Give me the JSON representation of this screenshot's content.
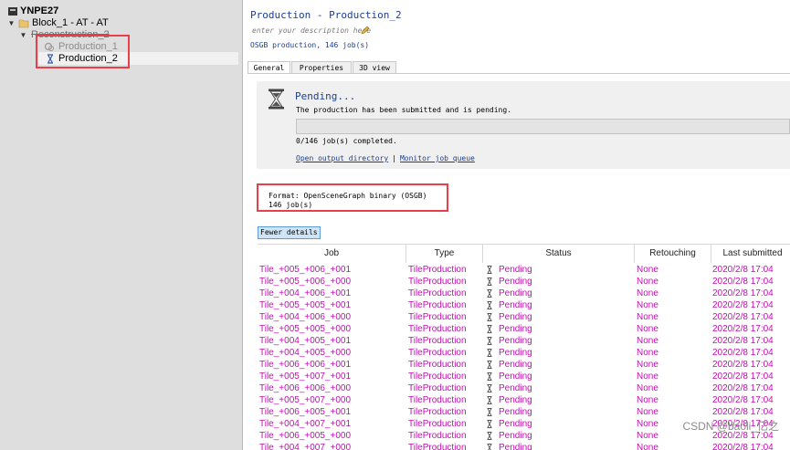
{
  "tree": {
    "root": "YNPE27",
    "block": "Block_1 - AT - AT",
    "reconstruction": "Reconstruction_2",
    "production_1": "Production_1",
    "production_2": "Production_2"
  },
  "panel": {
    "title": "Production - Production_2",
    "description_placeholder": "enter your description here",
    "summary": "OSGB production, 146 job(s)",
    "tabs": [
      "General",
      "Properties",
      "3D view"
    ],
    "status_title": "Pending...",
    "status_text": "The production has been submitted and is pending.",
    "progress": 0,
    "jobs_completed": "0/146 job(s) completed.",
    "link_output": "Open output directory",
    "link_separator": "|",
    "link_monitor": "Monitor job queue",
    "format_line": "Format: OpenSceneGraph binary (OSGB)",
    "jobs_count": "146 job(s)",
    "fewer_details": "Fewer details"
  },
  "jobs": {
    "columns": [
      "Job",
      "Type",
      "Status",
      "Retouching",
      "Last submitted"
    ],
    "rows": [
      [
        "Tile_+005_+006_+001",
        "TileProduction",
        "Pending",
        "None",
        "2020/2/8 17:04"
      ],
      [
        "Tile_+005_+006_+000",
        "TileProduction",
        "Pending",
        "None",
        "2020/2/8 17:04"
      ],
      [
        "Tile_+004_+006_+001",
        "TileProduction",
        "Pending",
        "None",
        "2020/2/8 17:04"
      ],
      [
        "Tile_+005_+005_+001",
        "TileProduction",
        "Pending",
        "None",
        "2020/2/8 17:04"
      ],
      [
        "Tile_+004_+006_+000",
        "TileProduction",
        "Pending",
        "None",
        "2020/2/8 17:04"
      ],
      [
        "Tile_+005_+005_+000",
        "TileProduction",
        "Pending",
        "None",
        "2020/2/8 17:04"
      ],
      [
        "Tile_+004_+005_+001",
        "TileProduction",
        "Pending",
        "None",
        "2020/2/8 17:04"
      ],
      [
        "Tile_+004_+005_+000",
        "TileProduction",
        "Pending",
        "None",
        "2020/2/8 17:04"
      ],
      [
        "Tile_+006_+006_+001",
        "TileProduction",
        "Pending",
        "None",
        "2020/2/8 17:04"
      ],
      [
        "Tile_+005_+007_+001",
        "TileProduction",
        "Pending",
        "None",
        "2020/2/8 17:04"
      ],
      [
        "Tile_+006_+006_+000",
        "TileProduction",
        "Pending",
        "None",
        "2020/2/8 17:04"
      ],
      [
        "Tile_+005_+007_+000",
        "TileProduction",
        "Pending",
        "None",
        "2020/2/8 17:04"
      ],
      [
        "Tile_+006_+005_+001",
        "TileProduction",
        "Pending",
        "None",
        "2020/2/8 17:04"
      ],
      [
        "Tile_+004_+007_+001",
        "TileProduction",
        "Pending",
        "None",
        "2020/2/8 17:04"
      ],
      [
        "Tile_+006_+005_+000",
        "TileProduction",
        "Pending",
        "None",
        "2020/2/8 17:04"
      ],
      [
        "Tile_+004_+007_+000",
        "TileProduction",
        "Pending",
        "None",
        "2020/2/8 17:04"
      ]
    ]
  },
  "colors": {
    "accent": "#1a3e95",
    "job_text": "#c010b0",
    "highlight_box": "#e8404a",
    "tree_bg": "#dedede"
  },
  "watermark": "CSDN @baoli_亿之"
}
